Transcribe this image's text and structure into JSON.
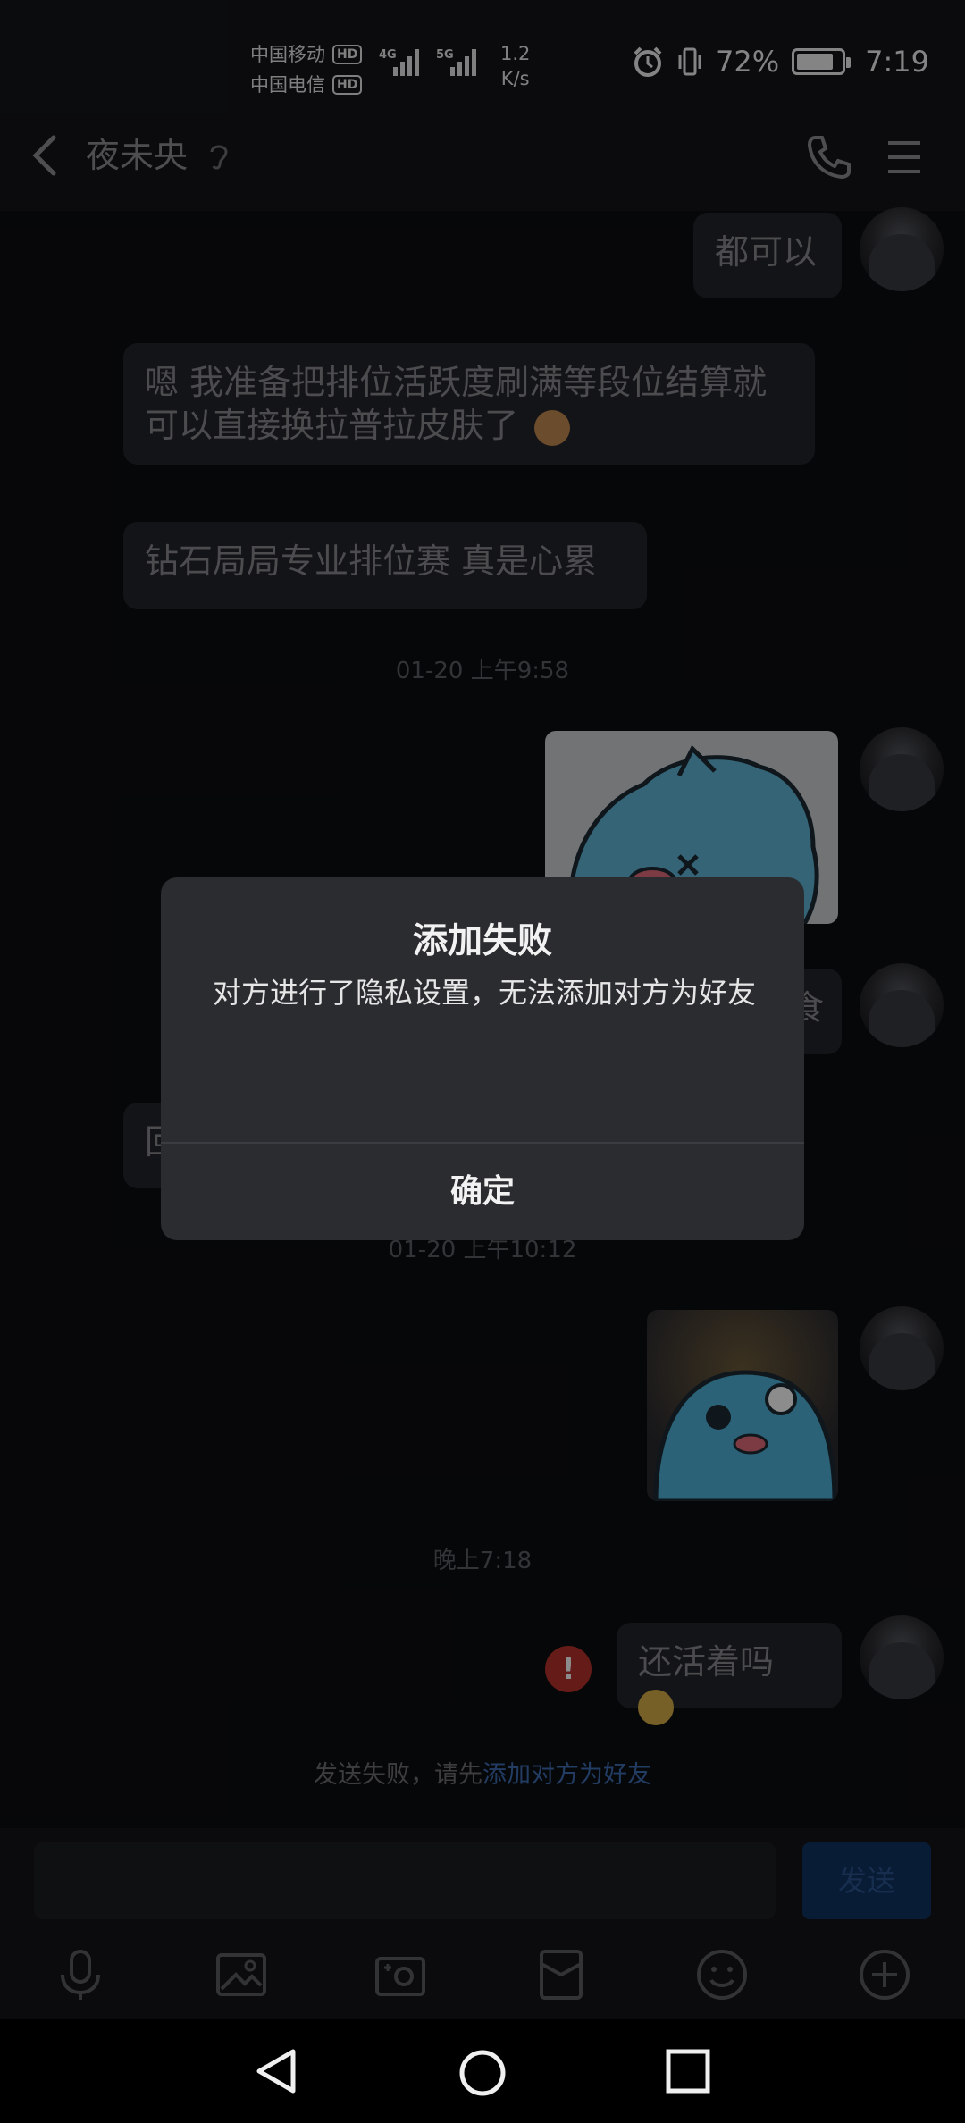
{
  "status_bar": {
    "carrier1": "中国移动",
    "carrier2": "中国电信",
    "hd": "HD",
    "net1": "4G",
    "net2": "5G",
    "speed_value": "1.2",
    "speed_unit": "K/s",
    "battery": "72%",
    "time": "7:19"
  },
  "header": {
    "title": "夜未央"
  },
  "messages": {
    "m1": "都可以",
    "m2": "嗯 我准备把排位活跃度刷满等段位结算就可以直接换拉普拉皮肤了",
    "m3": "钻石局局专业排位赛 真是心累",
    "ts1": "01-20 上午9:58",
    "partial_right": "食",
    "partial_left": "回",
    "ts2": "01-20 上午10:12",
    "ts3": "晚上7:18",
    "m_last": "还活着吗",
    "error_mark": "!",
    "fail_prefix": "发送失败，请先",
    "fail_link": "添加对方为好友"
  },
  "input": {
    "send_label": "发送"
  },
  "dialog": {
    "title": "添加失败",
    "message": "对方进行了隐私设置，无法添加对方为好友",
    "confirm": "确定"
  },
  "colors": {
    "background": "#0c0d10",
    "bubble": "#24252a",
    "link": "#3f6db5",
    "error": "#b8322a",
    "send_button": "#0f3463"
  }
}
